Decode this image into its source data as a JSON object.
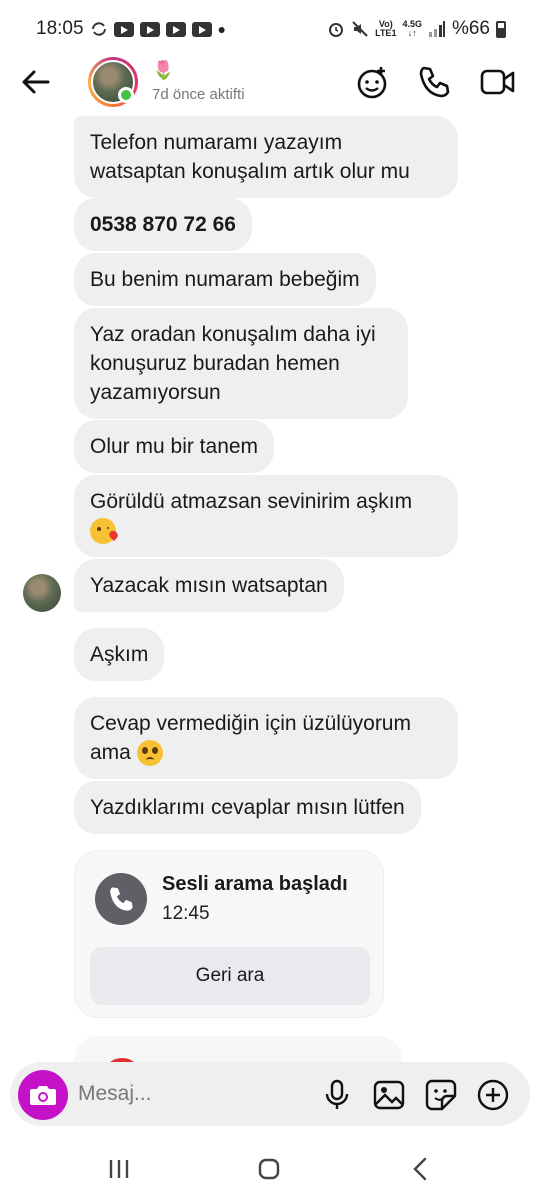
{
  "status_bar": {
    "time": "18:05",
    "network_top": "Vo)",
    "network_bottom": "LTE1",
    "gen_top": "4.5G",
    "gen_bottom": "↓↑",
    "battery": "%66"
  },
  "header": {
    "status_emoji": "🌷",
    "last_seen": "7d önce aktifti",
    "icons": [
      "back-arrow-icon",
      "effects-icon",
      "phone-icon",
      "video-icon"
    ]
  },
  "messages": [
    {
      "text": "Telefon numaramı yazayım watsaptan konuşalım artık olur mu"
    },
    {
      "text": "0538 870 72 66"
    },
    {
      "text": "Bu benim numaram bebeğim"
    },
    {
      "text": "Yaz oradan konuşalım daha iyi konuşuruz buradan hemen yazamıyorsun"
    },
    {
      "text": "Olur mu bir tanem"
    },
    {
      "text": "Görüldü atmazsan sevinirim aşkım",
      "emoji": "kiss"
    },
    {
      "text": "Yazacak mısın watsaptan"
    },
    {
      "text": "Aşkım"
    },
    {
      "text": "Cevap vermediğin için üzülüyorum ama",
      "emoji": "pleading"
    },
    {
      "text": "Yazdıklarımı cevaplar mısın lütfen"
    }
  ],
  "call": {
    "title": "Sesli arama başladı",
    "time": "12:45",
    "button": "Geri ara"
  },
  "composer": {
    "placeholder": "Mesaj...",
    "accent": "#c512c8"
  }
}
